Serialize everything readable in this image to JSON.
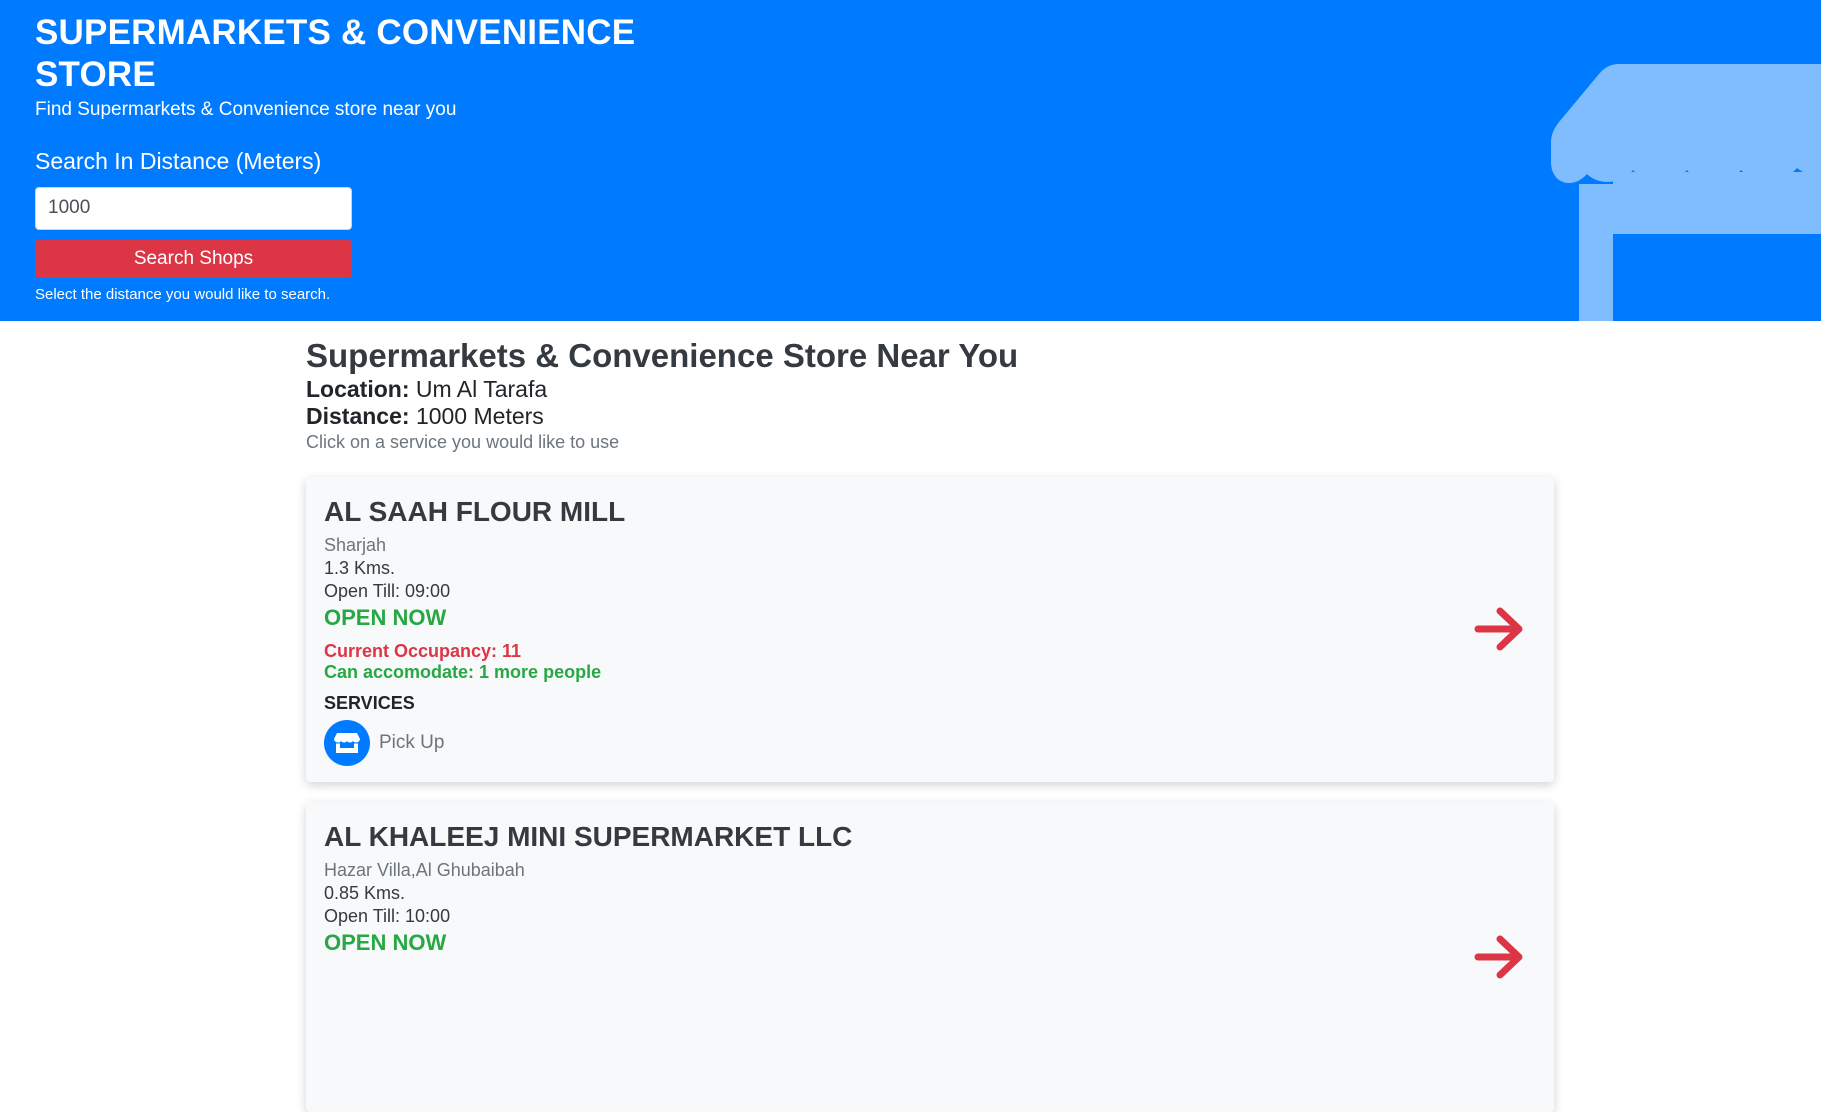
{
  "hero": {
    "title": "SUPERMARKETS & CONVENIENCE STORE",
    "subtitle": "Find Supermarkets & Convenience store near you",
    "distance_label": "Search In Distance (Meters)",
    "distance_value": "1000",
    "search_button": "Search Shops",
    "help_text": "Select the distance you would like to search.",
    "illustration_icon": "store-awning-icon"
  },
  "results": {
    "title": "Supermarkets & Convenience Store Near You",
    "location_key": "Location:",
    "location_value": "Um Al Tarafa",
    "distance_key": "Distance:",
    "distance_value": "1000 Meters",
    "hint": "Click on a service you would like to use"
  },
  "shops": [
    {
      "name": "AL SAAH FLOUR MILL",
      "area": "Sharjah",
      "distance": "1.3 Kms.",
      "open_till": "Open Till: 09:00",
      "status": "OPEN NOW",
      "occupancy": "Current Occupancy: 11",
      "accommodate": "Can accomodate: 1 more people",
      "services_heading": "SERVICES",
      "service_label": "Pick Up",
      "service_icon": "store-icon"
    },
    {
      "name": "AL KHALEEJ MINI SUPERMARKET LLC",
      "area": "Hazar Villa,Al Ghubaibah",
      "distance": "0.85 Kms.",
      "open_till": "Open Till: 10:00",
      "status": "OPEN NOW"
    }
  ],
  "colors": {
    "hero_bg": "#007bff",
    "illustration": "#80bdff",
    "danger": "#dc3545",
    "success": "#28a745",
    "card_bg": "#f8f9fa"
  }
}
